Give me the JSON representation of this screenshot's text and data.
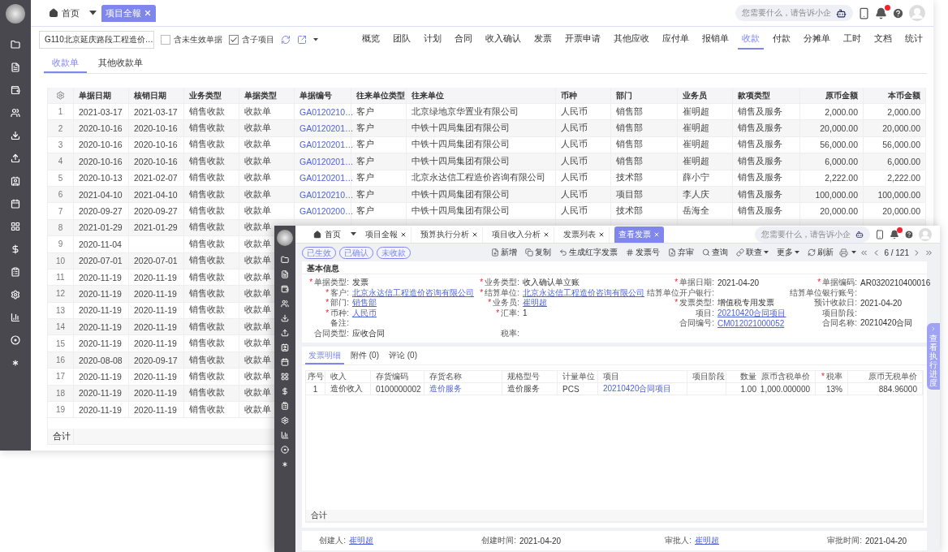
{
  "main_window": {
    "home_tab": "首页",
    "tabs": [
      {
        "label": "项目全報",
        "selected": true
      }
    ],
    "search": {
      "placeholder": "您需要什么，请告诉小企"
    },
    "project": {
      "value": "G110北京延庆路段工程造价…"
    },
    "filters": [
      {
        "label": "含未生效单据",
        "checked": false
      },
      {
        "label": "含子项目",
        "checked": true
      }
    ],
    "nav": [
      {
        "label": "概览",
        "selected": false
      },
      {
        "label": "团队",
        "selected": false
      },
      {
        "label": "计划",
        "selected": false
      },
      {
        "label": "合同",
        "selected": false
      },
      {
        "label": "收入确认",
        "selected": false
      },
      {
        "label": "发票",
        "selected": false
      },
      {
        "label": "开票申请",
        "selected": false
      },
      {
        "label": "其他应收",
        "selected": false
      },
      {
        "label": "应付单",
        "selected": false
      },
      {
        "label": "报销单",
        "selected": false
      },
      {
        "label": "收款",
        "selected": true
      },
      {
        "label": "付款",
        "selected": false
      },
      {
        "label": "分摊单",
        "selected": false
      },
      {
        "label": "工时",
        "selected": false
      },
      {
        "label": "文档",
        "selected": false
      },
      {
        "label": "统计",
        "selected": false
      }
    ],
    "subtabs": [
      {
        "label": "收款单",
        "selected": true
      },
      {
        "label": "其他收款单",
        "selected": false
      }
    ],
    "table": {
      "columns": [
        {
          "label": "单据日期",
          "kind": "text"
        },
        {
          "label": "核销日期",
          "kind": "text"
        },
        {
          "label": "业务类型",
          "kind": "text"
        },
        {
          "label": "单据类型",
          "kind": "text"
        },
        {
          "label": "单据编号",
          "kind": "link"
        },
        {
          "label": "往来单位类型",
          "kind": "text"
        },
        {
          "label": "往来单位",
          "kind": "text"
        },
        {
          "label": "币种",
          "kind": "text"
        },
        {
          "label": "部门",
          "kind": "text"
        },
        {
          "label": "业务员",
          "kind": "text"
        },
        {
          "label": "款项类型",
          "kind": "text"
        },
        {
          "label": "原币金额",
          "kind": "number"
        },
        {
          "label": "本币金额",
          "kind": "number"
        }
      ],
      "rows": [
        {
          "no": "1",
          "cells": [
            "2021-03-17",
            "2021-03-17",
            "销售收款",
            "收款单",
            "GA0120210…",
            "客户",
            "北京绿地京华置业有限公司",
            "人民币",
            "销售部",
            "崔明超",
            "销售及服务",
            "2,000.00",
            "2,000.00"
          ]
        },
        {
          "no": "2",
          "cells": [
            "2020-10-16",
            "2020-10-16",
            "销售收款",
            "收款单",
            "GA0120201…",
            "客户",
            "中铁十四局集团有限公司",
            "人民币",
            "销售部",
            "崔明超",
            "销售及服务",
            "20,000.00",
            "20,000.00"
          ]
        },
        {
          "no": "3",
          "cells": [
            "2020-10-16",
            "2020-10-16",
            "销售收款",
            "收款单",
            "GA0120201…",
            "客户",
            "中铁十四局集团有限公司",
            "人民币",
            "销售部",
            "崔明超",
            "销售及服务",
            "56,000.00",
            "56,000.00"
          ]
        },
        {
          "no": "4",
          "cells": [
            "2020-10-16",
            "2020-10-16",
            "销售收款",
            "收款单",
            "GA0120201…",
            "客户",
            "中铁十四局集团有限公司",
            "人民币",
            "销售部",
            "崔明超",
            "销售及服务",
            "6,000.00",
            "6,000.00"
          ]
        },
        {
          "no": "5",
          "cells": [
            "2020-10-13",
            "2021-02-07",
            "销售收款",
            "收款单",
            "GA0120201…",
            "客户",
            "北京永达信工程造价咨询有限公司",
            "人民币",
            "技术部",
            "薛小宁",
            "销售及服务",
            "2,222.00",
            "2,222.00"
          ]
        },
        {
          "no": "6",
          "cells": [
            "2021-04-10",
            "2021-04-10",
            "销售收款",
            "收款单",
            "GA0120210…",
            "客户",
            "中铁十四局集团有限公司",
            "人民币",
            "项目部",
            "李人庆",
            "销售及服务",
            "100,000.00",
            "100,000.00"
          ]
        },
        {
          "no": "7",
          "cells": [
            "2020-09-27",
            "2020-09-27",
            "销售收款",
            "收款单",
            "GA0120200…",
            "客户",
            "中铁十四局集团有限公司",
            "人民币",
            "技术部",
            "岳海全",
            "销售及服务",
            "20,000.00",
            "20,000.00"
          ]
        },
        {
          "no": "8",
          "cells": [
            "2021-01-29",
            "2021-01-29",
            "销售收款",
            "收款单"
          ]
        },
        {
          "no": "9",
          "cells": [
            "2020-11-04",
            null,
            "销售收款",
            "收款单"
          ]
        },
        {
          "no": "10",
          "cells": [
            "2020-07-01",
            "2020-07-01",
            "销售收款",
            "收款单"
          ]
        },
        {
          "no": "11",
          "cells": [
            "2020-11-19",
            "2020-11-19",
            "销售收款",
            "收款单"
          ]
        },
        {
          "no": "12",
          "cells": [
            "2020-11-19",
            "2020-11-19",
            "销售收款",
            "收款单"
          ]
        },
        {
          "no": "13",
          "cells": [
            "2020-11-19",
            "2020-11-19",
            "销售收款",
            "收款单"
          ]
        },
        {
          "no": "14",
          "cells": [
            "2020-11-19",
            "2020-11-19",
            "销售收款",
            "收款单"
          ]
        },
        {
          "no": "15",
          "cells": [
            "2020-11-19",
            "2020-11-19",
            "销售收款",
            "收款单"
          ]
        },
        {
          "no": "16",
          "cells": [
            "2020-08-08",
            "2020-09-17",
            "销售收款",
            "收款单"
          ]
        },
        {
          "no": "17",
          "cells": [
            "2020-11-19",
            "2020-11-19",
            "销售收款",
            "收款单"
          ]
        },
        {
          "no": "18",
          "cells": [
            "2020-11-19",
            "2020-11-19",
            "销售收款",
            "收款单"
          ]
        },
        {
          "no": "19",
          "cells": [
            "2020-11-19",
            "2020-11-19",
            "销售收款",
            "收款单"
          ]
        }
      ],
      "total_label": "合计"
    }
  },
  "invoice_window": {
    "tabs": [
      {
        "label": "首页",
        "kind": "home",
        "selected": false
      },
      {
        "label": "项目全報",
        "kind": "page",
        "selected": false
      },
      {
        "label": "预算执行分析",
        "kind": "page",
        "selected": false
      },
      {
        "label": "项目收入分析",
        "kind": "page",
        "selected": false
      },
      {
        "label": "发票列表",
        "kind": "page",
        "selected": false
      },
      {
        "label": "查看发票",
        "kind": "page",
        "selected": true
      }
    ],
    "search": {
      "placeholder": "您需要什么，请告诉小企"
    },
    "statuses": [
      "已生效",
      "已确认",
      "未收款"
    ],
    "actions": [
      {
        "label": "新增",
        "kind": "button"
      },
      {
        "label": "复制",
        "kind": "button"
      },
      {
        "label": "生成红字发票",
        "kind": "button"
      },
      {
        "label": "发票号",
        "kind": "button"
      },
      {
        "label": "弃审",
        "kind": "button"
      },
      {
        "label": "查询",
        "kind": "button"
      },
      {
        "label": "联查",
        "kind": "menu"
      },
      {
        "label": "更多",
        "kind": "menu"
      },
      {
        "label": "刷新",
        "kind": "button"
      }
    ],
    "pager": "6 / 121",
    "section_title": "基本信息",
    "fields": [
      {
        "kind": "field",
        "marker": "*",
        "label": "单据类型:",
        "value": "发票",
        "link": false
      },
      {
        "kind": "field",
        "marker": "*",
        "label": "业务类型:",
        "value": "收入确认单立账",
        "link": false
      },
      {
        "kind": "field",
        "marker": "*",
        "label": "单据日期:",
        "value": "2021-04-20",
        "link": false
      },
      {
        "kind": "field",
        "marker": "*",
        "label": "单据编码:",
        "value": "AR0320210400016",
        "link": false
      },
      {
        "kind": "field",
        "marker": "*",
        "label": "客户:",
        "value": "北京永达信工程造价咨询有限公司",
        "link": true
      },
      {
        "kind": "field",
        "marker": "*",
        "label": "结算单位:",
        "value": "北京永达信工程造价咨询有限公司",
        "link": true
      },
      {
        "kind": "field",
        "label": "结算单位开户银行:"
      },
      {
        "kind": "field",
        "label": "结算单位银行账号:"
      },
      {
        "kind": "field",
        "marker": "*",
        "label": "部门:",
        "value": "销售部",
        "link": true
      },
      {
        "kind": "field",
        "marker": "*",
        "label": "业务员:",
        "value": "崔明超",
        "link": true
      },
      {
        "kind": "field",
        "marker": "*",
        "label": "发票类型:",
        "value": "增值税专用发票",
        "link": false
      },
      {
        "kind": "field",
        "label": "预计收款日:",
        "value": "2021-04-20",
        "link": false
      },
      {
        "kind": "field",
        "marker": "*",
        "label": "币种:",
        "value": "人民币",
        "link": true
      },
      {
        "kind": "field",
        "marker": "*",
        "label": "汇率:",
        "value": "1",
        "link": false
      },
      {
        "kind": "field",
        "label": "项目:",
        "value": "20210420合同项目",
        "link": true
      },
      {
        "kind": "field",
        "label": "项目阶段:"
      },
      {
        "kind": "field",
        "label": "备注:"
      },
      {
        "kind": "spacer"
      },
      {
        "kind": "field",
        "label": "合同编号:",
        "value": "CM012021000052",
        "link": true
      },
      {
        "kind": "field",
        "label": "合同名称:",
        "value": "20210420合同",
        "link": false
      },
      {
        "kind": "field",
        "label": "合同类型:",
        "value": "应收合同",
        "link": false
      },
      {
        "kind": "field",
        "label": "税率:"
      },
      {
        "kind": "spacer"
      },
      {
        "kind": "spacer"
      }
    ],
    "detail_tabs": [
      {
        "label": "发票明细",
        "selected": true
      },
      {
        "label": "附件 (0)",
        "selected": false
      },
      {
        "label": "评论 (0)",
        "selected": false
      }
    ],
    "detail_table": {
      "columns": [
        {
          "label": "序号",
          "kind": "index"
        },
        {
          "label": "收入",
          "kind": "text"
        },
        {
          "label": "存货编码",
          "kind": "text"
        },
        {
          "label": "存货名称",
          "kind": "link"
        },
        {
          "label": "规格型号",
          "kind": "text"
        },
        {
          "label": "计量单位",
          "kind": "text"
        },
        {
          "label": "项目",
          "kind": "link"
        },
        {
          "label": "项目阶段",
          "kind": "text"
        },
        {
          "label": "数量",
          "kind": "number"
        },
        {
          "label": "原币含税单价",
          "kind": "number"
        },
        {
          "label": "税率",
          "kind": "number",
          "marker": "*"
        },
        {
          "label": "原币无税单价",
          "kind": "number"
        }
      ],
      "rows": [
        [
          "1",
          "造价收入",
          "0100000002",
          "造价服务",
          "造价服务",
          "PCS",
          "20210420合同项目",
          null,
          "1.00",
          "1,000.000000",
          "13%",
          "884.96000"
        ]
      ],
      "total_label": "合计"
    },
    "footer": [
      {
        "label": "创建人:",
        "value": "崔明超",
        "link": true
      },
      {
        "label": "创建时间:",
        "value": "2021-04-20",
        "link": false
      },
      {
        "label": "审批人:",
        "value": "崔明超",
        "link": true
      },
      {
        "label": "审批时间:",
        "value": "2021-04-20",
        "link": false
      }
    ],
    "side_tab": "查看执行进度"
  }
}
